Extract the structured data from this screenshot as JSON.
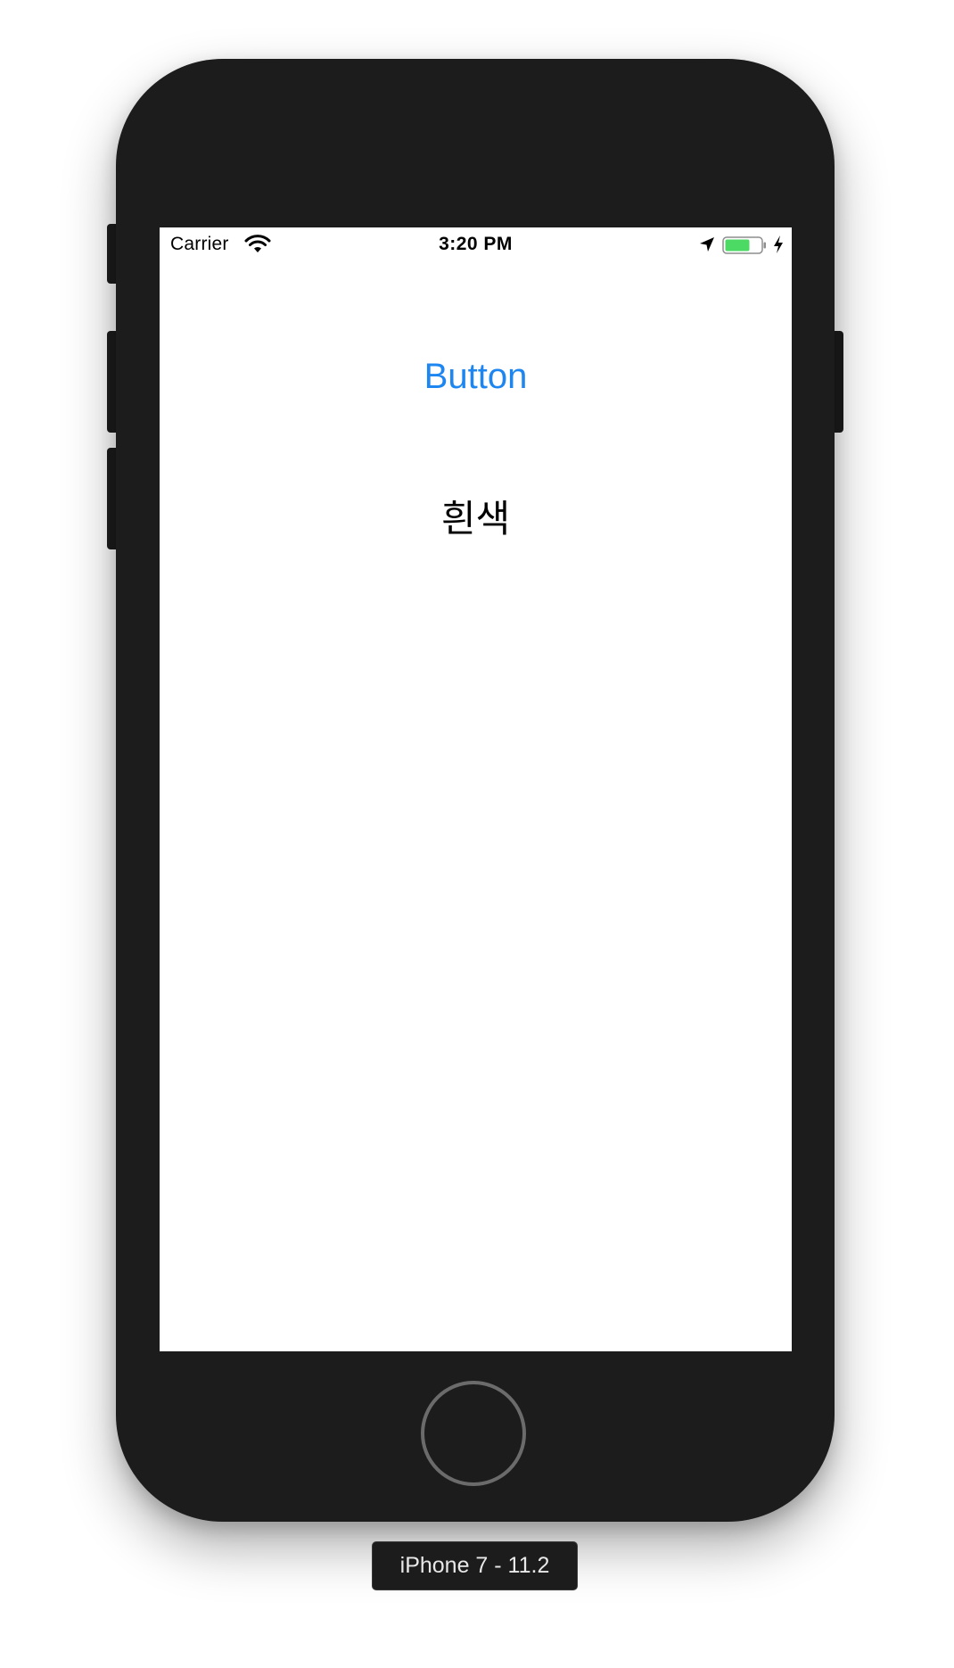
{
  "simulator": {
    "device_label": "iPhone 7 - 11.2"
  },
  "status_bar": {
    "carrier": "Carrier",
    "time": "3:20 PM",
    "battery_color": "#4cd964",
    "icons": [
      "wifi-icon",
      "location-icon",
      "battery-icon",
      "charging-bolt-icon"
    ]
  },
  "app": {
    "button_label": "Button",
    "label_text": "흰색",
    "button_color": "#1e86f0"
  }
}
